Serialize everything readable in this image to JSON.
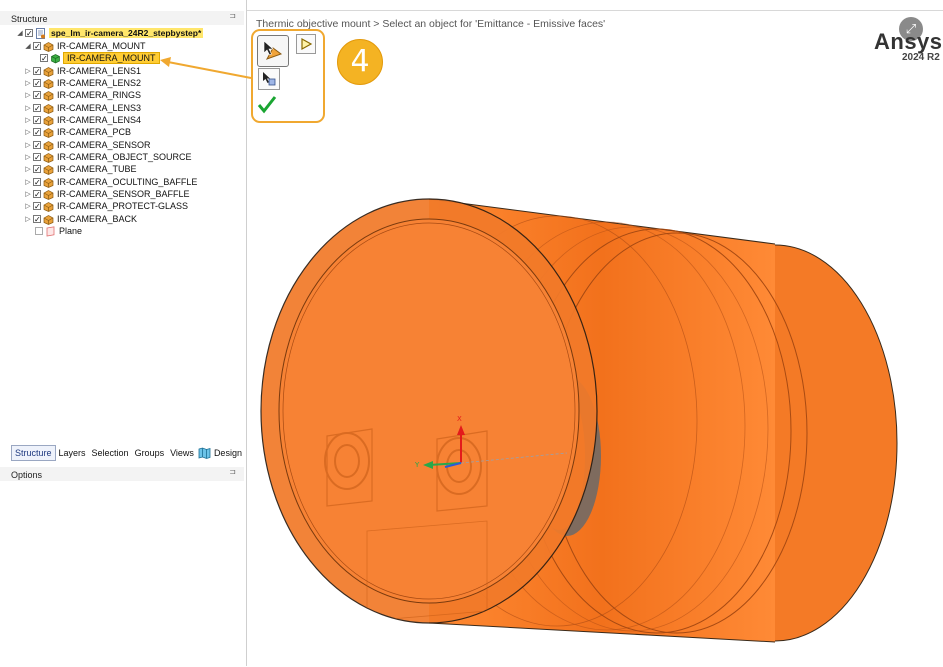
{
  "panels": {
    "structure_title": "Structure",
    "options_title": "Options",
    "pin_glyph": "⊐"
  },
  "tree": {
    "root_label": "spe_lm_ir-camera_24R2_stepbystep*",
    "items": [
      {
        "label": "IR-CAMERA_MOUNT",
        "expanded": true
      },
      {
        "label": "IR-CAMERA_MOUNT",
        "selected": true
      },
      {
        "label": "IR-CAMERA_LENS1"
      },
      {
        "label": "IR-CAMERA_LENS2"
      },
      {
        "label": "IR-CAMERA_RINGS"
      },
      {
        "label": "IR-CAMERA_LENS3"
      },
      {
        "label": "IR-CAMERA_LENS4"
      },
      {
        "label": "IR-CAMERA_PCB"
      },
      {
        "label": "IR-CAMERA_SENSOR"
      },
      {
        "label": "IR-CAMERA_OBJECT_SOURCE"
      },
      {
        "label": "IR-CAMERA_TUBE"
      },
      {
        "label": "IR-CAMERA_OCULTING_BAFFLE"
      },
      {
        "label": "IR-CAMERA_SENSOR_BAFFLE"
      },
      {
        "label": "IR-CAMERA_PROTECT-GLASS"
      },
      {
        "label": "IR-CAMERA_BACK"
      },
      {
        "label": "Plane"
      }
    ]
  },
  "tabs": {
    "structure": "Structure",
    "layers": "Layers",
    "selection": "Selection",
    "groups": "Groups",
    "views": "Views",
    "design": "Design"
  },
  "viewport": {
    "breadcrumb": "Thermic objective mount > Select an object for 'Emittance - Emissive faces'",
    "logo": "Ansys",
    "version": "2024 R2",
    "step_number": "4",
    "axis_x_label": "X",
    "axis_y_label": "Y"
  },
  "colors": {
    "orange_fill": "#ff7f27",
    "orange_dark": "#cc5500",
    "highlight_yellow": "#ffcc33",
    "callout_orange": "#f0a830",
    "badge_fill": "#f4b323"
  },
  "icons": {
    "select_tool": "select-arrow-icon",
    "play": "play-triangle-icon",
    "select_body": "select-body-icon",
    "validate": "green-checkmark-icon",
    "expand": "expand-icon"
  }
}
